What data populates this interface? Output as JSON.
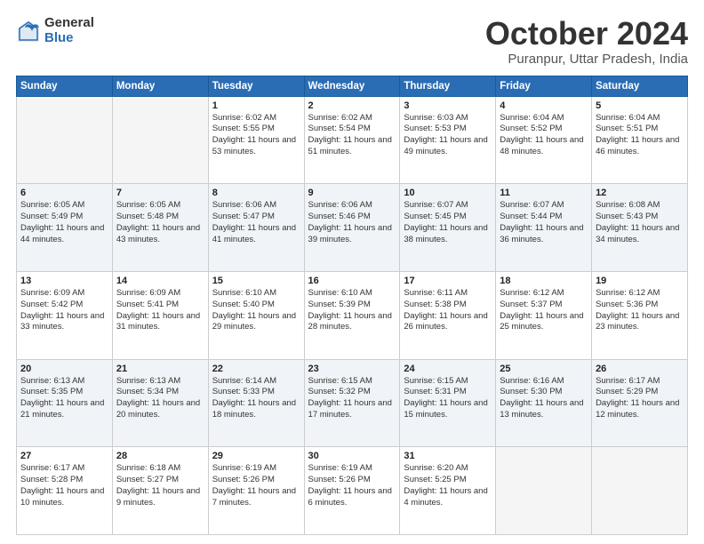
{
  "header": {
    "logo_general": "General",
    "logo_blue": "Blue",
    "month_title": "October 2024",
    "location": "Puranpur, Uttar Pradesh, India"
  },
  "days_of_week": [
    "Sunday",
    "Monday",
    "Tuesday",
    "Wednesday",
    "Thursday",
    "Friday",
    "Saturday"
  ],
  "weeks": [
    [
      {
        "day": "",
        "info": ""
      },
      {
        "day": "",
        "info": ""
      },
      {
        "day": "1",
        "info": "Sunrise: 6:02 AM\nSunset: 5:55 PM\nDaylight: 11 hours and 53 minutes."
      },
      {
        "day": "2",
        "info": "Sunrise: 6:02 AM\nSunset: 5:54 PM\nDaylight: 11 hours and 51 minutes."
      },
      {
        "day": "3",
        "info": "Sunrise: 6:03 AM\nSunset: 5:53 PM\nDaylight: 11 hours and 49 minutes."
      },
      {
        "day": "4",
        "info": "Sunrise: 6:04 AM\nSunset: 5:52 PM\nDaylight: 11 hours and 48 minutes."
      },
      {
        "day": "5",
        "info": "Sunrise: 6:04 AM\nSunset: 5:51 PM\nDaylight: 11 hours and 46 minutes."
      }
    ],
    [
      {
        "day": "6",
        "info": "Sunrise: 6:05 AM\nSunset: 5:49 PM\nDaylight: 11 hours and 44 minutes."
      },
      {
        "day": "7",
        "info": "Sunrise: 6:05 AM\nSunset: 5:48 PM\nDaylight: 11 hours and 43 minutes."
      },
      {
        "day": "8",
        "info": "Sunrise: 6:06 AM\nSunset: 5:47 PM\nDaylight: 11 hours and 41 minutes."
      },
      {
        "day": "9",
        "info": "Sunrise: 6:06 AM\nSunset: 5:46 PM\nDaylight: 11 hours and 39 minutes."
      },
      {
        "day": "10",
        "info": "Sunrise: 6:07 AM\nSunset: 5:45 PM\nDaylight: 11 hours and 38 minutes."
      },
      {
        "day": "11",
        "info": "Sunrise: 6:07 AM\nSunset: 5:44 PM\nDaylight: 11 hours and 36 minutes."
      },
      {
        "day": "12",
        "info": "Sunrise: 6:08 AM\nSunset: 5:43 PM\nDaylight: 11 hours and 34 minutes."
      }
    ],
    [
      {
        "day": "13",
        "info": "Sunrise: 6:09 AM\nSunset: 5:42 PM\nDaylight: 11 hours and 33 minutes."
      },
      {
        "day": "14",
        "info": "Sunrise: 6:09 AM\nSunset: 5:41 PM\nDaylight: 11 hours and 31 minutes."
      },
      {
        "day": "15",
        "info": "Sunrise: 6:10 AM\nSunset: 5:40 PM\nDaylight: 11 hours and 29 minutes."
      },
      {
        "day": "16",
        "info": "Sunrise: 6:10 AM\nSunset: 5:39 PM\nDaylight: 11 hours and 28 minutes."
      },
      {
        "day": "17",
        "info": "Sunrise: 6:11 AM\nSunset: 5:38 PM\nDaylight: 11 hours and 26 minutes."
      },
      {
        "day": "18",
        "info": "Sunrise: 6:12 AM\nSunset: 5:37 PM\nDaylight: 11 hours and 25 minutes."
      },
      {
        "day": "19",
        "info": "Sunrise: 6:12 AM\nSunset: 5:36 PM\nDaylight: 11 hours and 23 minutes."
      }
    ],
    [
      {
        "day": "20",
        "info": "Sunrise: 6:13 AM\nSunset: 5:35 PM\nDaylight: 11 hours and 21 minutes."
      },
      {
        "day": "21",
        "info": "Sunrise: 6:13 AM\nSunset: 5:34 PM\nDaylight: 11 hours and 20 minutes."
      },
      {
        "day": "22",
        "info": "Sunrise: 6:14 AM\nSunset: 5:33 PM\nDaylight: 11 hours and 18 minutes."
      },
      {
        "day": "23",
        "info": "Sunrise: 6:15 AM\nSunset: 5:32 PM\nDaylight: 11 hours and 17 minutes."
      },
      {
        "day": "24",
        "info": "Sunrise: 6:15 AM\nSunset: 5:31 PM\nDaylight: 11 hours and 15 minutes."
      },
      {
        "day": "25",
        "info": "Sunrise: 6:16 AM\nSunset: 5:30 PM\nDaylight: 11 hours and 13 minutes."
      },
      {
        "day": "26",
        "info": "Sunrise: 6:17 AM\nSunset: 5:29 PM\nDaylight: 11 hours and 12 minutes."
      }
    ],
    [
      {
        "day": "27",
        "info": "Sunrise: 6:17 AM\nSunset: 5:28 PM\nDaylight: 11 hours and 10 minutes."
      },
      {
        "day": "28",
        "info": "Sunrise: 6:18 AM\nSunset: 5:27 PM\nDaylight: 11 hours and 9 minutes."
      },
      {
        "day": "29",
        "info": "Sunrise: 6:19 AM\nSunset: 5:26 PM\nDaylight: 11 hours and 7 minutes."
      },
      {
        "day": "30",
        "info": "Sunrise: 6:19 AM\nSunset: 5:26 PM\nDaylight: 11 hours and 6 minutes."
      },
      {
        "day": "31",
        "info": "Sunrise: 6:20 AM\nSunset: 5:25 PM\nDaylight: 11 hours and 4 minutes."
      },
      {
        "day": "",
        "info": ""
      },
      {
        "day": "",
        "info": ""
      }
    ]
  ]
}
